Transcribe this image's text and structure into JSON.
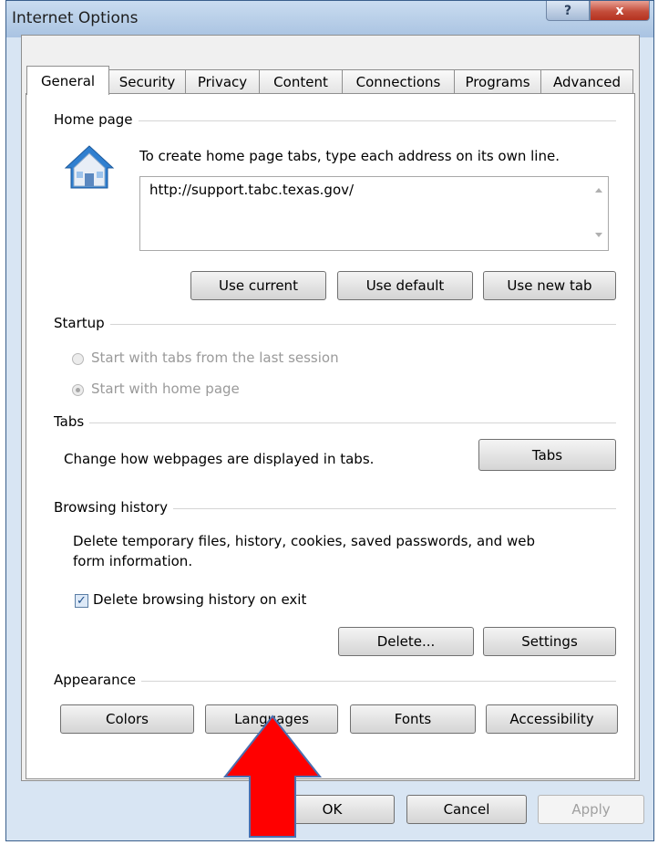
{
  "window": {
    "title": "Internet Options",
    "help_label": "?",
    "close_label": "x"
  },
  "tabs": [
    "General",
    "Security",
    "Privacy",
    "Content",
    "Connections",
    "Programs",
    "Advanced"
  ],
  "active_tab": "General",
  "home_page": {
    "group_label": "Home page",
    "description": "To create home page tabs, type each address on its own line.",
    "url_value": "http://support.tabc.texas.gov/",
    "buttons": {
      "use_current": "Use current",
      "use_default": "Use default",
      "use_new_tab": "Use new tab"
    }
  },
  "startup": {
    "group_label": "Startup",
    "options": [
      {
        "label": "Start with tabs from the last session",
        "selected": false
      },
      {
        "label": "Start with home page",
        "selected": true
      }
    ]
  },
  "tabs_group": {
    "group_label": "Tabs",
    "description": "Change how webpages are displayed in tabs.",
    "button": "Tabs"
  },
  "browsing_history": {
    "group_label": "Browsing history",
    "description_line1": "Delete temporary files, history, cookies, saved passwords, and web",
    "description_line2": "form information.",
    "checkbox_label": "Delete browsing history on exit",
    "checkbox_checked": true,
    "buttons": {
      "delete": "Delete...",
      "settings": "Settings"
    }
  },
  "appearance": {
    "group_label": "Appearance",
    "buttons": {
      "colors": "Colors",
      "languages": "Languages",
      "fonts": "Fonts",
      "accessibility": "Accessibility"
    }
  },
  "footer": {
    "ok": "OK",
    "cancel": "Cancel",
    "apply": "Apply"
  },
  "colors": {
    "arrow_fill": "#ff0000",
    "arrow_stroke": "#4a6fb0"
  }
}
